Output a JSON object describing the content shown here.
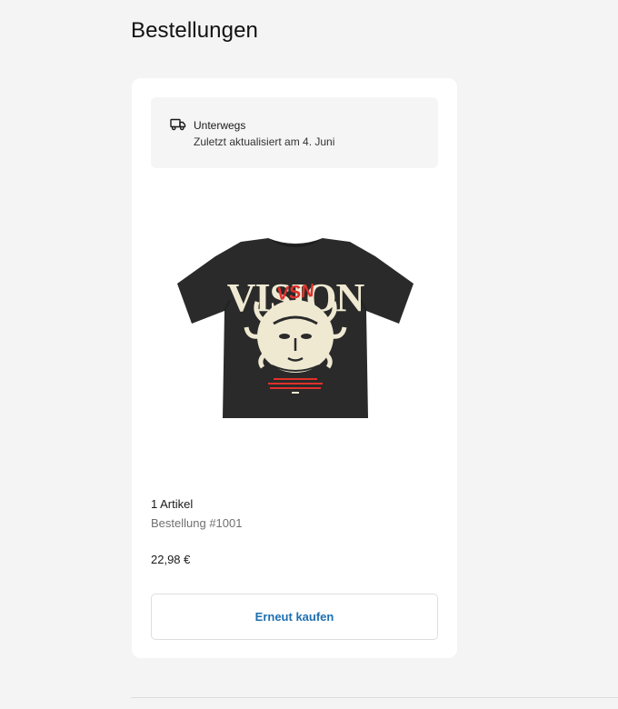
{
  "page": {
    "title": "Bestellungen"
  },
  "order": {
    "status": {
      "icon": "truck-icon",
      "title": "Unterwegs",
      "subtitle": "Zuletzt aktualisiert am 4. Juni"
    },
    "product_image": {
      "description_icon": "tshirt-image",
      "print_text": "VISION",
      "overlay_text": "VSN"
    },
    "item_count": "1 Artikel",
    "order_number": "Bestellung #1001",
    "total": "22,98 €",
    "buy_again_label": "Erneut kaufen"
  },
  "colors": {
    "background": "#f4f4f4",
    "card": "#ffffff",
    "status_box": "#f5f5f5",
    "accent_link": "#1f6fb0",
    "shirt": "#2a2a2a",
    "print_cream": "#efe9d2",
    "print_red": "#e0312b"
  }
}
